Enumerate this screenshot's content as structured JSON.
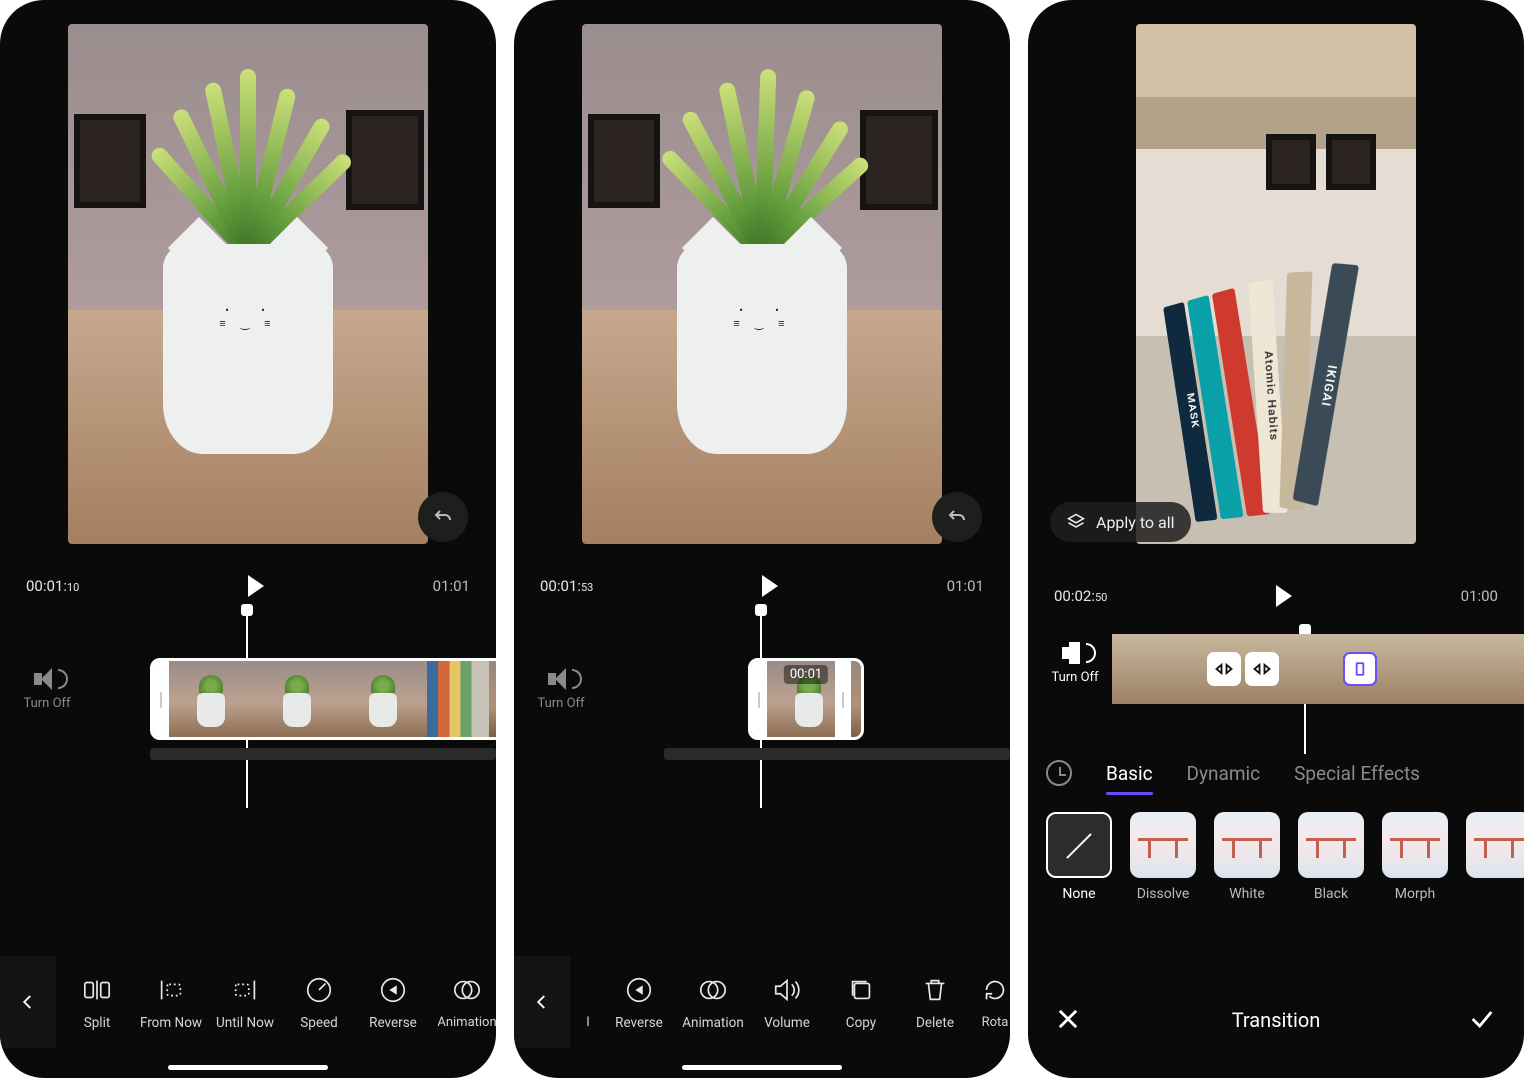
{
  "panel1": {
    "time_current": "00:01:",
    "time_frames": "10",
    "time_total": "01:01",
    "turn_off": "Turn Off",
    "tools": [
      {
        "id": "split",
        "label": "Split"
      },
      {
        "id": "from-now",
        "label": "From Now"
      },
      {
        "id": "until-now",
        "label": "Until Now"
      },
      {
        "id": "speed",
        "label": "Speed"
      },
      {
        "id": "reverse",
        "label": "Reverse"
      },
      {
        "id": "animation",
        "label": "Animation"
      }
    ]
  },
  "panel2": {
    "time_current": "00:01:",
    "time_frames": "53",
    "time_total": "01:01",
    "turn_off": "Turn Off",
    "clip_label": "00:01",
    "tools": [
      {
        "id": "cut-left",
        "label": "I"
      },
      {
        "id": "reverse",
        "label": "Reverse"
      },
      {
        "id": "animation",
        "label": "Animation"
      },
      {
        "id": "volume",
        "label": "Volume"
      },
      {
        "id": "copy",
        "label": "Copy"
      },
      {
        "id": "delete",
        "label": "Delete"
      },
      {
        "id": "rotate",
        "label": "Rota"
      }
    ]
  },
  "panel3": {
    "time_current": "00:02:",
    "time_frames": "50",
    "time_total": "01:00",
    "turn_off": "Turn Off",
    "apply_all_label": "Apply to all",
    "tabs": {
      "basic": "Basic",
      "dynamic": "Dynamic",
      "fx": "Special Effects"
    },
    "transitions": [
      {
        "id": "none",
        "label": "None"
      },
      {
        "id": "dissolve",
        "label": "Dissolve"
      },
      {
        "id": "white",
        "label": "White"
      },
      {
        "id": "black",
        "label": "Black"
      },
      {
        "id": "morph",
        "label": "Morph"
      },
      {
        "id": "next",
        "label": ""
      }
    ],
    "panel_title": "Transition",
    "books": [
      "MASK",
      "",
      "",
      "Atomic Habits",
      "",
      "IKIGAI"
    ]
  }
}
